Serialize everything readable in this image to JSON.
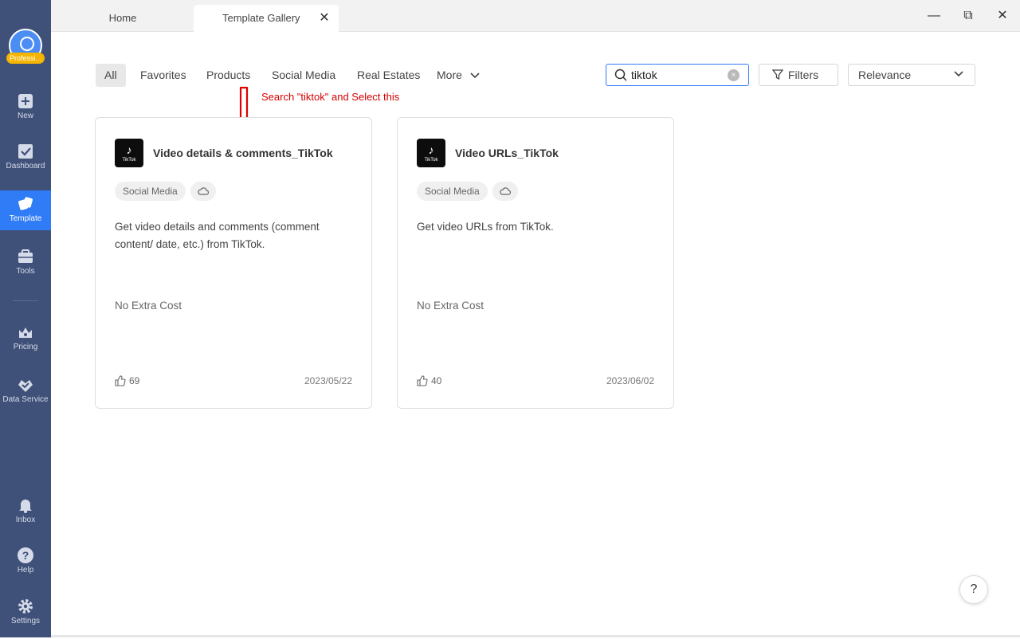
{
  "sidebar": {
    "plan_badge": "Professi...",
    "items": [
      {
        "label": "New",
        "icon": "plus-square-icon"
      },
      {
        "label": "Dashboard",
        "icon": "checklist-icon"
      },
      {
        "label": "Template",
        "icon": "template-icon"
      },
      {
        "label": "Tools",
        "icon": "toolbox-icon"
      },
      {
        "label": "Pricing",
        "icon": "crown-icon"
      },
      {
        "label": "Data Service",
        "icon": "heart-check-icon"
      },
      {
        "label": "Inbox",
        "icon": "bell-icon"
      },
      {
        "label": "Help",
        "icon": "question-icon"
      },
      {
        "label": "Settings",
        "icon": "gear-icon"
      }
    ],
    "active": "Template"
  },
  "tabs": [
    {
      "label": "Home"
    },
    {
      "label": "Template Gallery",
      "close": "✕"
    }
  ],
  "window_controls": {
    "minimize": "—",
    "restore": "⧉",
    "close": "✕"
  },
  "categories": [
    "All",
    "Favorites",
    "Products",
    "Social Media",
    "Real Estates",
    "More"
  ],
  "search": {
    "value": "tiktok",
    "clear": "×"
  },
  "filters_label": "Filters",
  "sort": {
    "selected": "Relevance"
  },
  "annotation": "Search \"tiktok\" and Select this",
  "cards": [
    {
      "title": "Video details & comments_TikTok",
      "logo_text": "TikTok",
      "tag": "Social Media",
      "description": "Get video details and comments (comment content/ date, etc.) from TikTok.",
      "cost": "No Extra Cost",
      "likes": "69",
      "date": "2023/05/22"
    },
    {
      "title": "Video URLs_TikTok",
      "logo_text": "TikTok",
      "tag": "Social Media",
      "description": "Get video URLs from TikTok.",
      "cost": "No Extra Cost",
      "likes": "40",
      "date": "2023/06/02"
    }
  ],
  "help_fab": "?",
  "colors": {
    "sidebar": "#3f5079",
    "accent": "#2f7cf6",
    "annotation": "#d40000",
    "badge": "#f5b400"
  }
}
